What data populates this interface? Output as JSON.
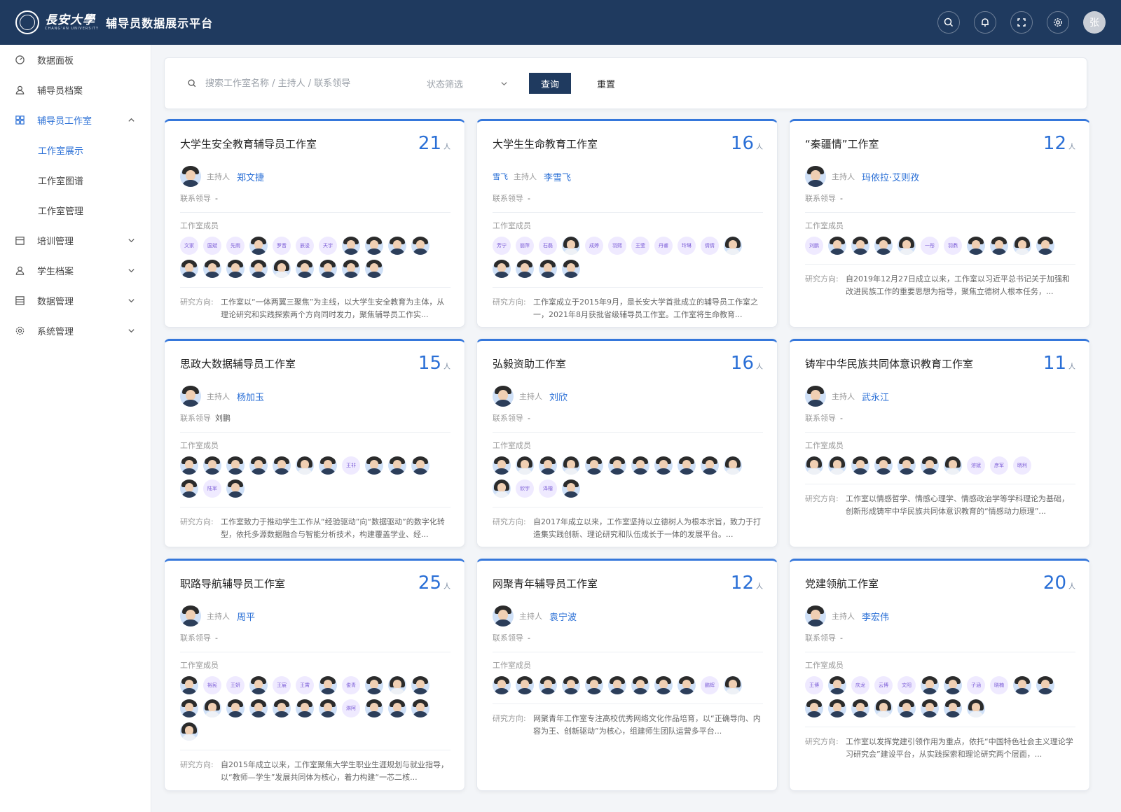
{
  "header": {
    "university_name": "長安大學",
    "university_sub": "CHANG'AN UNIVERSITY",
    "app_title": "辅导员数据展示平台",
    "user_avatar_text": "张",
    "icons": [
      "search-icon",
      "bell-icon",
      "fullscreen-icon",
      "gear-icon"
    ]
  },
  "sidebar": {
    "items": [
      {
        "label": "数据面板",
        "icon": "dashboard-icon"
      },
      {
        "label": "辅导员档案",
        "icon": "user-icon"
      },
      {
        "label": "辅导员工作室",
        "icon": "grid-icon",
        "expanded": true,
        "children": [
          "工作室展示",
          "工作室图谱",
          "工作室管理"
        ]
      },
      {
        "label": "培训管理",
        "icon": "calendar-icon"
      },
      {
        "label": "学生档案",
        "icon": "user-icon"
      },
      {
        "label": "数据管理",
        "icon": "table-icon"
      },
      {
        "label": "系统管理",
        "icon": "gear-icon"
      }
    ]
  },
  "search": {
    "placeholder": "搜索工作室名称 / 主持人 / 联系领导",
    "status_placeholder": "状态筛选",
    "query_label": "查询",
    "reset_label": "重置"
  },
  "labels": {
    "host": "主持人",
    "leader": "联系领导",
    "members": "工作室成员",
    "research": "研究方向:",
    "unit": "人"
  },
  "studios": [
    {
      "title": "大学生安全教育辅导员工作室",
      "count": "21",
      "host": "郑文捷",
      "leader": "-",
      "members": [
        "文家",
        "国斌",
        "先雨",
        "f",
        "罗音",
        "辰浚",
        "天宇",
        "f",
        "f",
        "f",
        "f",
        "f",
        "f",
        "f",
        "f",
        "w",
        "f",
        "f",
        "f",
        "f"
      ],
      "research": "工作室以“一体两翼三聚焦”为主线，以大学生安全教育为主体，从理论研究和实践探索两个方向同时发力，聚焦辅导员工作实..."
    },
    {
      "title": "大学生生命教育工作室",
      "count": "16",
      "host": "李雪飞",
      "host_text_avatar": "雪飞",
      "leader": "-",
      "members": [
        "芳宁",
        "丽萍",
        "石磊",
        "w",
        "成婷",
        "羽熙",
        "王莹",
        "丹睿",
        "玲琳",
        "倩倩",
        "w",
        "f",
        "f",
        "f",
        "f"
      ],
      "research": "工作室成立于2015年9月，是长安大学首批成立的辅导员工作室之一，2021年8月获批省级辅导员工作室。工作室将生命教育..."
    },
    {
      "title": "“秦疆情”工作室",
      "count": "12",
      "host": "玛依拉·艾则孜",
      "leader": "-",
      "members": [
        "刘鹏",
        "f",
        "f",
        "f",
        "w",
        "一彤",
        "羽鼎",
        "f",
        "f",
        "w",
        "f"
      ],
      "research": "自2019年12月27日成立以来，工作室以习近平总书记关于加强和改进民族工作的重要思想为指导，聚焦立德树人根本任务，..."
    },
    {
      "title": "思政大数据辅导员工作室",
      "count": "15",
      "host": "杨加玉",
      "leader": "刘鹏",
      "members": [
        "f",
        "f",
        "f",
        "f",
        "f",
        "w",
        "f",
        "王非",
        "f",
        "f",
        "f",
        "f",
        "陆军",
        "f"
      ],
      "research": "工作室致力于推动学生工作从“经验驱动”向“数据驱动”的数字化转型，依托多源数据融合与智能分析技术，构建覆盖学业、经..."
    },
    {
      "title": "弘毅资助工作室",
      "count": "16",
      "host": "刘欣",
      "leader": "-",
      "members": [
        "f",
        "w",
        "f",
        "w",
        "f",
        "f",
        "f",
        "f",
        "f",
        "f",
        "w",
        "w",
        "欣宇",
        "泽楷",
        "f"
      ],
      "research": "自2017年成立以来，工作室坚持以立德树人为根本宗旨，致力于打造集实践创新、理论研究和队伍成长于一体的发展平台。..."
    },
    {
      "title": "铸牢中华民族共同体意识教育工作室",
      "count": "11",
      "host": "武永江",
      "leader": "-",
      "members": [
        "w",
        "w",
        "f",
        "f",
        "f",
        "f",
        "w",
        "溶斌",
        "彦军",
        "晓利"
      ],
      "research": "工作室以情感哲学、情感心理学、情感政治学等学科理论为基础，创新形成铸牢中华民族共同体意识教育的“情感动力原理”..."
    },
    {
      "title": "职路导航辅导员工作室",
      "count": "25",
      "host": "周平",
      "leader": "-",
      "members": [
        "f",
        "裕民",
        "王妍",
        "f",
        "王宸",
        "王霄",
        "f",
        "俊青",
        "f",
        "w",
        "f",
        "f",
        "w",
        "f",
        "f",
        "f",
        "f",
        "f",
        "淋阿",
        "f",
        "f",
        "f",
        "w"
      ],
      "research": "自2015年成立以来，工作室聚焦大学生职业生涯规划与就业指导，以“教师—学生”发展共同体为核心，着力构建“一芯二核..."
    },
    {
      "title": "网聚青年辅导员工作室",
      "count": "12",
      "host": "袁宁波",
      "leader": "-",
      "members": [
        "f",
        "f",
        "f",
        "f",
        "f",
        "f",
        "f",
        "f",
        "f",
        "鹏辉",
        "w"
      ],
      "research": "网聚青年工作室专注高校优秀网络文化作品培育，以“正确导向、内容为王、创新驱动”为核心，组建师生团队运营多平台..."
    },
    {
      "title": "党建领航工作室",
      "count": "20",
      "host": "李宏伟",
      "leader": "-",
      "members": [
        "王博",
        "f",
        "庆龙",
        "云博",
        "文阳",
        "f",
        "f",
        "子涵",
        "晓楠",
        "f",
        "f",
        "f",
        "f",
        "f",
        "w",
        "f",
        "f",
        "f",
        "w"
      ],
      "research": "工作室以发挥党建引领作用为重点，依托“中国特色社会主义理论学习研究会”建设平台，从实践探索和理论研究两个层面，..."
    }
  ]
}
